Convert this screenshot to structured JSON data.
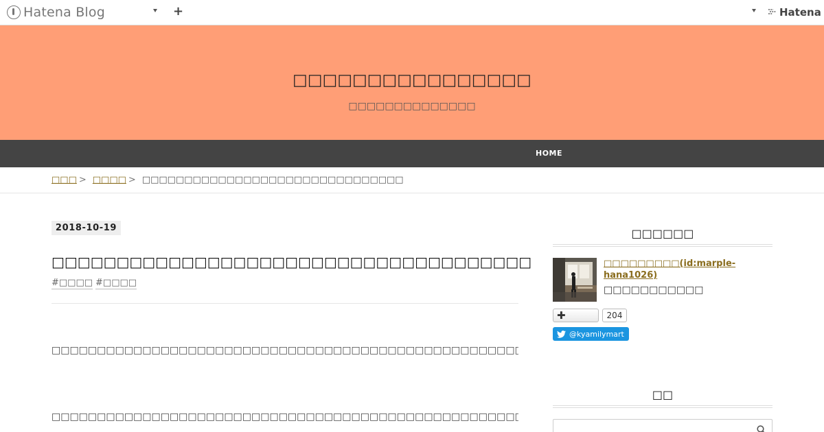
{
  "topbar": {
    "brand": "Hatena Blog",
    "add_label": "+",
    "hatena": "Hatena"
  },
  "header": {
    "title": "□□□□□□□□□□□□□□□□",
    "description": "□□□□□□□□□□□□□□"
  },
  "nav": {
    "home": "HOME"
  },
  "breadcrumb": {
    "top": "□□□",
    "category": "□□□□",
    "current": "□□□□□□□□□□□□□□□□□□□□□□□□□□□□□□□"
  },
  "entry": {
    "date": "2018-10-19",
    "title": "□□□□□□□□□□□□□□□□□□□□□□□□□□□□□□□□□□□□□",
    "tags": [
      "#□□□□",
      "#□□□□"
    ],
    "paragraphs": [
      "□□□□□□□□□□□□□□□□□□□□□□□□□□□□□□□□□□□□□□□□□□□□□□□□□□□□□□□□□□□□□□□□□□□□□□□□□□□□□□□□□□□□□□□□□□□□□□□□□□□□□□□□□□□□□□□□□□□□□□□□□□□□□□□□□□□□□□□□□□□□□□□□□□□□□",
      "□□□□□□□□□□□□□□□□□□□□□□□□□□□□□□□□□□□□□□□□□□□□□□□□□□□□□□□□□□□□□□□□□□□□□□□□□□□□□□□□□□□□□□□□□□□□□□□□□□□□□□□□□□□□□□□□□□□□□□□□□□□□□□□□□□□□□□□□□□□□□□□□□□□□□□□□□□□□□□□□□"
    ]
  },
  "sidebar": {
    "profile_heading": "□□□□□□",
    "profile_name": "□□□□□□□□□(id:marple-hana1026)",
    "profile_desc": "□□□□□□□□□□□",
    "follow_count": "204",
    "twitter_handle": "@kyamilymart",
    "search_heading": "□□"
  },
  "colors": {
    "header_bg": "#ff9e76",
    "nav_bg": "#444444",
    "link": "#8a6d1e",
    "twitter": "#1b95e0"
  },
  "icons": {
    "brand": "hatena-blog-logo-icon",
    "dropdown": "caret-down-icon",
    "add": "plus-icon",
    "twitter": "twitter-bird-icon",
    "search": "search-icon"
  }
}
